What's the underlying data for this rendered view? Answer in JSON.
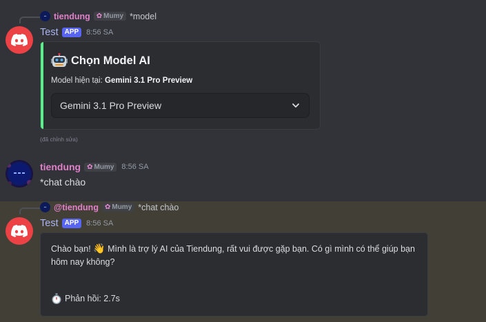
{
  "message1": {
    "reply": {
      "username": "tiendung",
      "tag": "Mumy",
      "text": "*model"
    },
    "bot_name": "Test",
    "app_badge": "APP",
    "time": "8:56 SA",
    "embed": {
      "title": "Chọn Model AI",
      "desc_label": "Model hiện tại:",
      "desc_value": "Gemini 3.1 Pro Preview",
      "select_value": "Gemini 3.1 Pro Preview",
      "accent": "#57f287"
    },
    "edited_label": "(đã chỉnh sửa)"
  },
  "message2": {
    "username": "tiendung",
    "tag": "Mumy",
    "time": "8:56 SA",
    "text": "*chat chào"
  },
  "message3": {
    "reply": {
      "username": "@tiendung",
      "tag": "Mumy",
      "text": "*chat chào"
    },
    "bot_name": "Test",
    "app_badge": "APP",
    "time": "8:56 SA",
    "embed": {
      "line1_a": "Chào bạn!",
      "line1_b": "Mình là trợ lý AI của Tiendung, rất vui được gặp bạn. Có gì mình có thể giúp bạn",
      "line2": "hôm nay không?",
      "footer": "Phản hồi: 2.7s"
    }
  },
  "colors": {
    "background": "#323339",
    "highlight": "#423f36",
    "embed_bg": "#2b2d31",
    "bot_avatar": "#ed4245",
    "app_badge": "#5865f2",
    "username": "#e080c8"
  }
}
